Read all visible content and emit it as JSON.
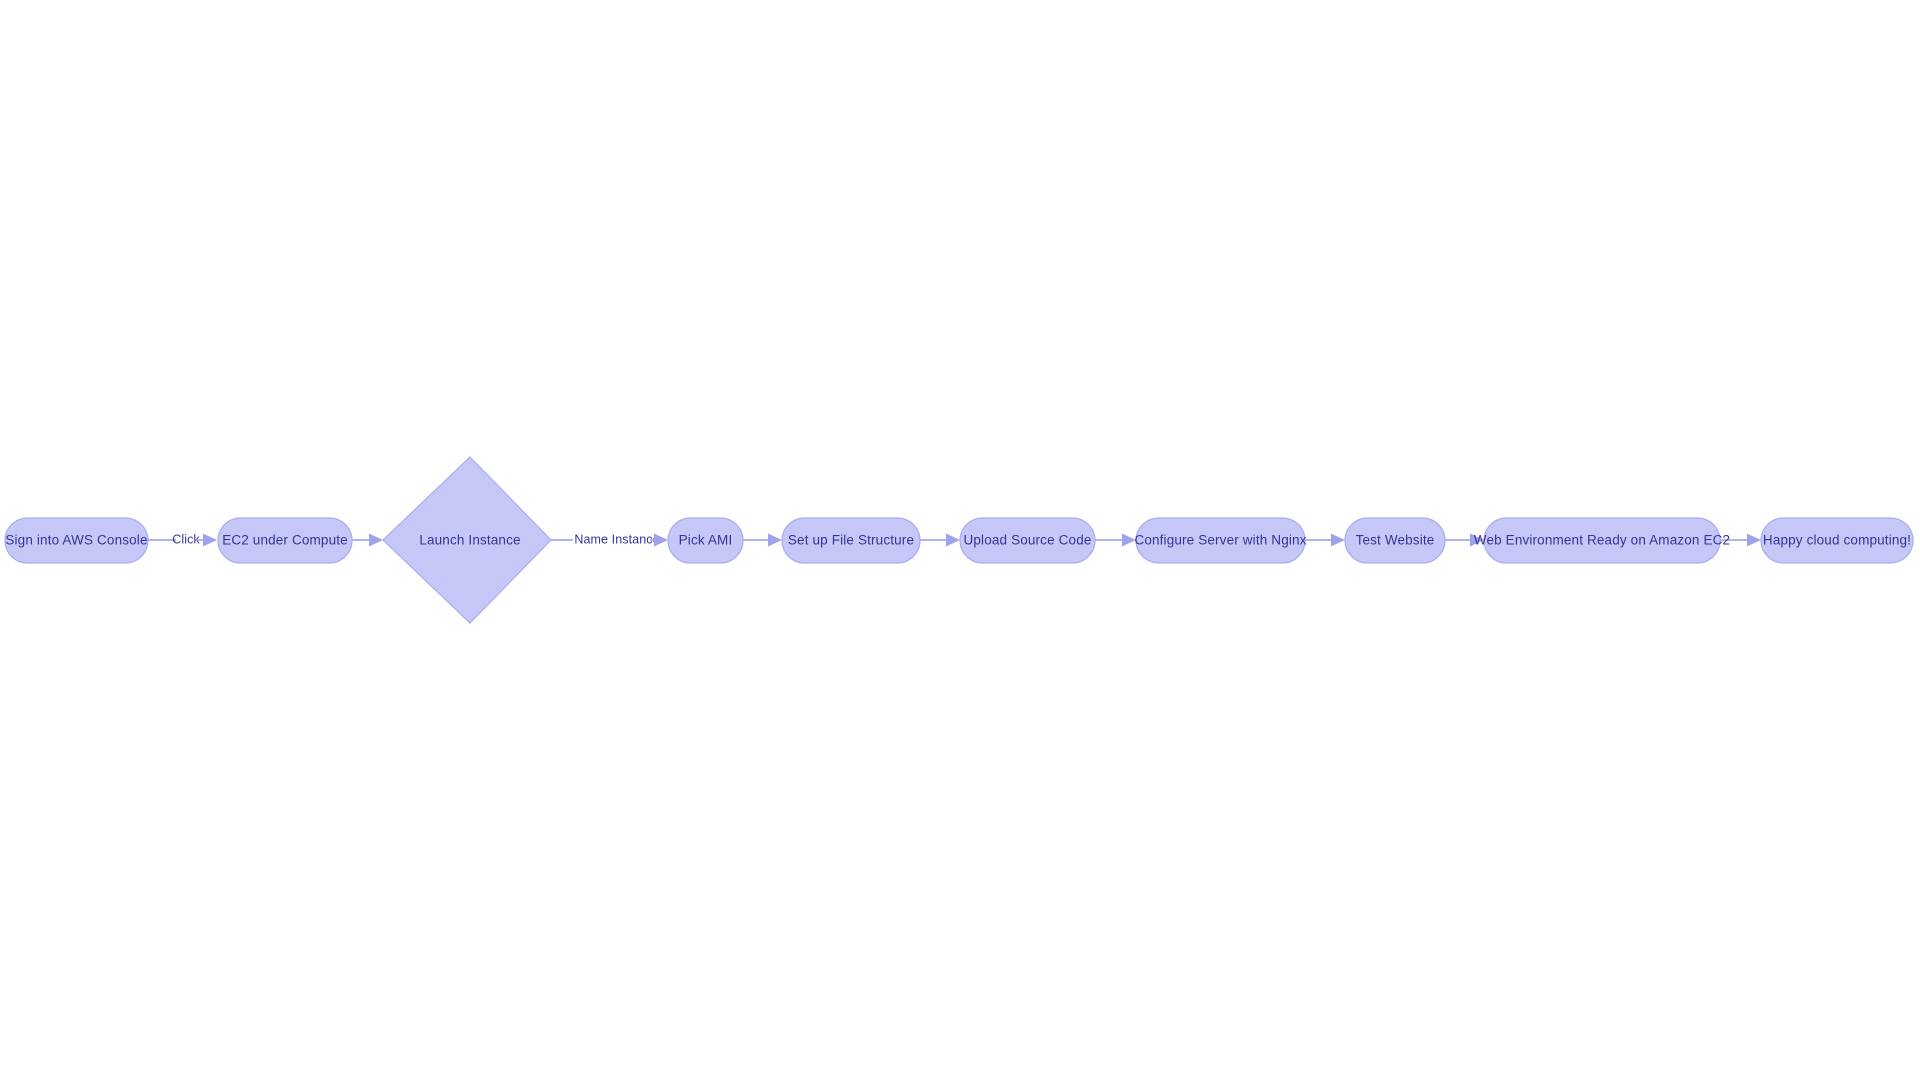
{
  "diagram": {
    "type": "flowchart",
    "orientation": "left-to-right",
    "background_color": "#ffffff",
    "node_fill_color": "#c5c8f7",
    "node_border_color": "#a9adf0",
    "text_color": "#343499",
    "edge_color": "#a4a8ee",
    "nodes": [
      {
        "id": "n0",
        "label": "Sign into AWS Console",
        "shape": "stadium"
      },
      {
        "id": "n1",
        "label": "EC2 under Compute",
        "shape": "stadium"
      },
      {
        "id": "n2",
        "label": "Launch Instance",
        "shape": "diamond"
      },
      {
        "id": "n3",
        "label": "Pick AMI",
        "shape": "stadium"
      },
      {
        "id": "n4",
        "label": "Set up File Structure",
        "shape": "stadium"
      },
      {
        "id": "n5",
        "label": "Upload Source Code",
        "shape": "stadium"
      },
      {
        "id": "n6",
        "label": "Configure Server with Nginx",
        "shape": "stadium"
      },
      {
        "id": "n7",
        "label": "Test Website",
        "shape": "stadium"
      },
      {
        "id": "n8",
        "label": "Web Environment Ready on Amazon EC2",
        "shape": "stadium"
      },
      {
        "id": "n9",
        "label": "Happy cloud computing!",
        "shape": "stadium"
      }
    ],
    "edges": [
      {
        "from": "n0",
        "to": "n1",
        "label": "Click"
      },
      {
        "from": "n1",
        "to": "n2",
        "label": ""
      },
      {
        "from": "n2",
        "to": "n3",
        "label": "Name Instance"
      },
      {
        "from": "n3",
        "to": "n4",
        "label": ""
      },
      {
        "from": "n4",
        "to": "n5",
        "label": ""
      },
      {
        "from": "n5",
        "to": "n6",
        "label": ""
      },
      {
        "from": "n6",
        "to": "n7",
        "label": ""
      },
      {
        "from": "n7",
        "to": "n8",
        "label": ""
      },
      {
        "from": "n8",
        "to": "n9",
        "label": ""
      }
    ]
  }
}
